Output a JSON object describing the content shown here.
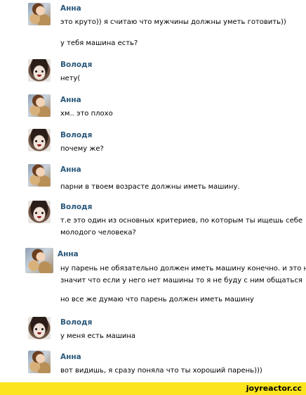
{
  "messages": [
    {
      "author": "Анна",
      "lines": [
        "это круто)) я считаю что мужчины должны уметь готовить))",
        "",
        "у тебя машина есть?"
      ]
    },
    {
      "author": "Володя",
      "lines": [
        "нету("
      ]
    },
    {
      "author": "Анна",
      "lines": [
        "хм.. это плохо"
      ]
    },
    {
      "author": "Володя",
      "lines": [
        "почему же?"
      ]
    },
    {
      "author": "Анна",
      "lines": [
        "парни в твоем возрасте должны иметь машину."
      ]
    },
    {
      "author": "Володя",
      "lines": [
        "т.е это один из основных критериев, по которым ты ищешь себе",
        "молодого человека?"
      ]
    },
    {
      "author": "Анна",
      "lines": [
        "ну парень не обязательно должен иметь машину конечно. и это не",
        "значит что если у него нет машины то я не буду с ним общаться",
        "",
        "но все же думаю что парень должен иметь машину"
      ]
    },
    {
      "author": "Володя",
      "lines": [
        "у меня есть машина"
      ]
    },
    {
      "author": "Анна",
      "lines": [
        "вот видишь, я сразу поняла что ты хороший парень)))"
      ]
    }
  ],
  "footer": {
    "site": "joyreactor.cc"
  },
  "colors": {
    "name": "#2b587a",
    "footer_bg": "#fce51e"
  }
}
